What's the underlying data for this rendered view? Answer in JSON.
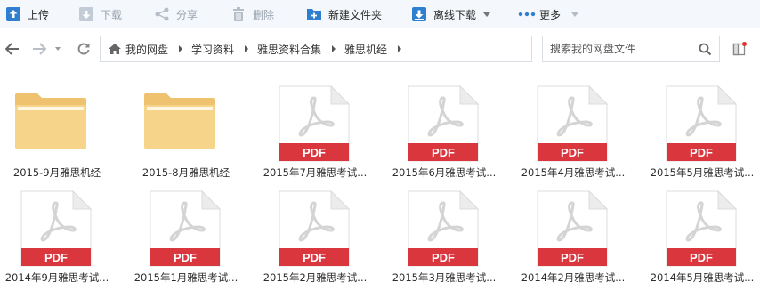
{
  "toolbar": {
    "upload": "上传",
    "download": "下载",
    "share": "分享",
    "delete": "删除",
    "new_folder": "新建文件夹",
    "offline_download": "离线下载",
    "more": "更多"
  },
  "breadcrumb": [
    "我的网盘",
    "学习资料",
    "雅思资料合集",
    "雅思机经"
  ],
  "search": {
    "placeholder": "搜索我的网盘文件"
  },
  "files": [
    {
      "type": "folder",
      "name": "2015-9月雅思机经"
    },
    {
      "type": "folder",
      "name": "2015-8月雅思机经"
    },
    {
      "type": "pdf",
      "name": "2015年7月雅思考试...",
      "badge": "PDF"
    },
    {
      "type": "pdf",
      "name": "2015年6月雅思考试...",
      "badge": "PDF"
    },
    {
      "type": "pdf",
      "name": "2015年4月雅思考试...",
      "badge": "PDF"
    },
    {
      "type": "pdf",
      "name": "2015年5月雅思考试...",
      "badge": "PDF"
    },
    {
      "type": "pdf",
      "name": "2014年9月雅思考试...",
      "badge": "PDF"
    },
    {
      "type": "pdf",
      "name": "2015年1月雅思考试...",
      "badge": "PDF"
    },
    {
      "type": "pdf",
      "name": "2015年2月雅思考试...",
      "badge": "PDF"
    },
    {
      "type": "pdf",
      "name": "2015年3月雅思考试...",
      "badge": "PDF"
    },
    {
      "type": "pdf",
      "name": "2014年2月雅思考试...",
      "badge": "PDF"
    },
    {
      "type": "pdf",
      "name": "2014年5月雅思考试...",
      "badge": "PDF"
    }
  ],
  "colors": {
    "accent_blue": "#2f7fd1",
    "pdf_red": "#d9363e",
    "folder_yellow": "#f6d58b",
    "disabled_gray": "#9aa4b0"
  },
  "icons": [
    "upload-icon",
    "download-icon",
    "share-icon",
    "delete-icon",
    "new-folder-icon",
    "offline-download-icon",
    "more-icon",
    "back-arrow-icon",
    "forward-arrow-icon",
    "refresh-icon",
    "home-icon",
    "search-icon",
    "folder-icon",
    "pdf-icon"
  ]
}
